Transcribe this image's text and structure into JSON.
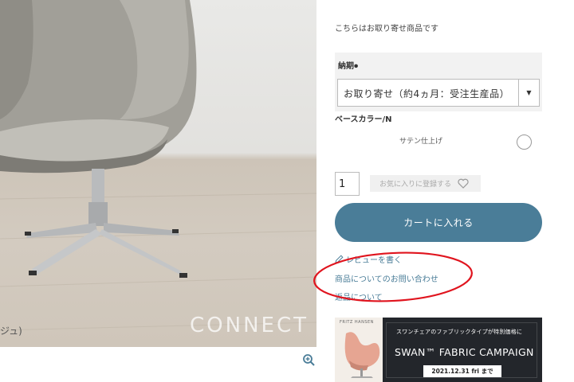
{
  "product_image": {
    "watermark": "CONNECT",
    "caption": "ジュ)"
  },
  "order_note": "こちらはお取り寄せ商品です",
  "delivery": {
    "label": "納期",
    "required_mark": "●",
    "selected": "お取り寄せ（約4ヵ月：受注生産品）",
    "arrow_icon": "caret-down-icon"
  },
  "base_color": {
    "label": "ベースカラー/N",
    "option_label": "サテン仕上げ"
  },
  "quantity": {
    "value": "1"
  },
  "favorite": {
    "label": "お気に入りに登録する",
    "icon": "heart-icon"
  },
  "cart": {
    "label": "カートに入れる",
    "color": "#4a7d98"
  },
  "links": {
    "review": "レビューを書く",
    "inquiry": "商品についてのお問い合わせ",
    "returns": "返品について"
  },
  "annotation": {
    "color": "#e0141e"
  },
  "banner": {
    "brand": "FRITZ HANSEN",
    "subtitle": "スワンチェアのファブリックタイプが特別価格に",
    "title": "SWAN™ FABRIC CAMPAIGN",
    "date": "2021.12.31 fri まで"
  }
}
